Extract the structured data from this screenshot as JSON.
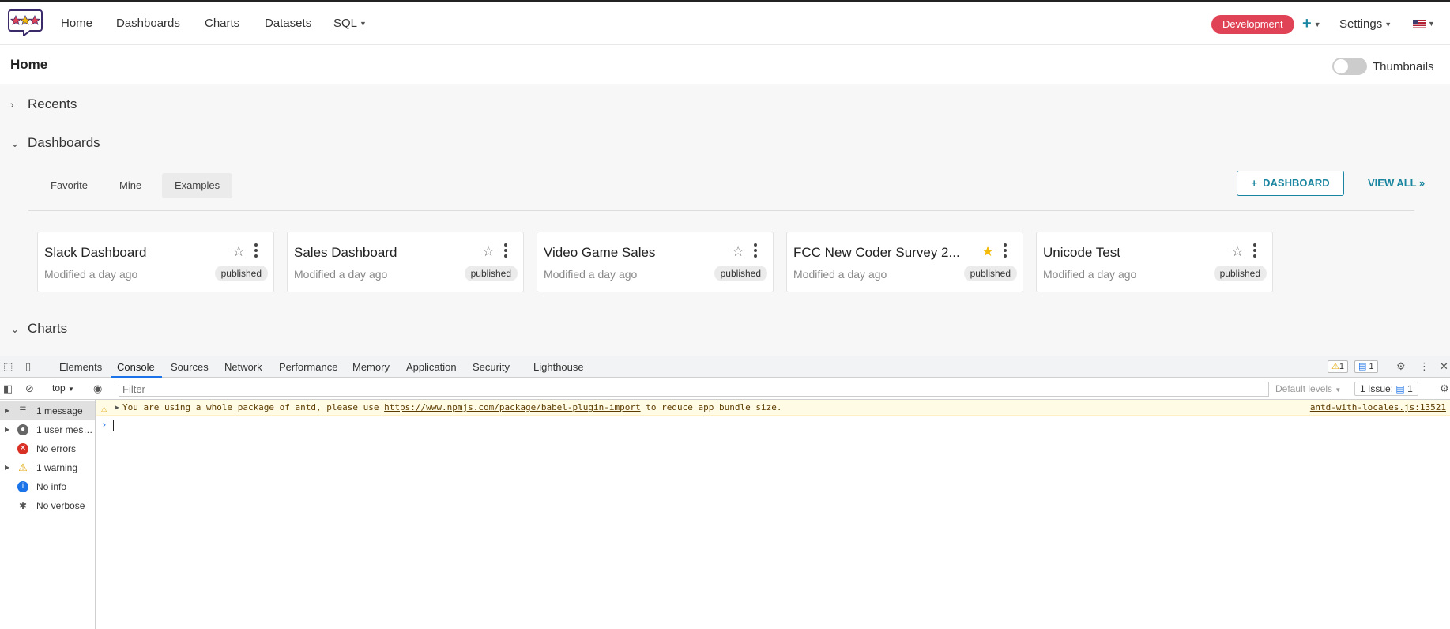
{
  "nav": {
    "links": [
      "Home",
      "Dashboards",
      "Charts",
      "Datasets",
      "SQL"
    ],
    "environment": "Development",
    "plus": "+",
    "settings": "Settings"
  },
  "page": {
    "title": "Home",
    "thumbnails_label": "Thumbnails",
    "thumbnails_on": false
  },
  "sections": {
    "recents": "Recents",
    "dashboards": "Dashboards",
    "charts": "Charts"
  },
  "dashboard_tabs": [
    "Favorite",
    "Mine",
    "Examples"
  ],
  "active_tab": "Examples",
  "actions": {
    "add_dashboard": "DASHBOARD",
    "view_all": "VIEW ALL »"
  },
  "cards": [
    {
      "title": "Slack Dashboard",
      "modified": "Modified a day ago",
      "status": "published",
      "favorite": false
    },
    {
      "title": "Sales Dashboard",
      "modified": "Modified a day ago",
      "status": "published",
      "favorite": false
    },
    {
      "title": "Video Game Sales",
      "modified": "Modified a day ago",
      "status": "published",
      "favorite": false
    },
    {
      "title": "FCC New Coder Survey 2...",
      "modified": "Modified a day ago",
      "status": "published",
      "favorite": true
    },
    {
      "title": "Unicode Test",
      "modified": "Modified a day ago",
      "status": "published",
      "favorite": false
    }
  ],
  "devtools": {
    "tabs": [
      "Elements",
      "Console",
      "Sources",
      "Network",
      "Performance",
      "Memory",
      "Application",
      "Security",
      "Lighthouse"
    ],
    "active_tab": "Console",
    "warning_count": "1",
    "message_count": "1",
    "context": "top",
    "filter_placeholder": "Filter",
    "levels": "Default levels",
    "issues_label": "1 Issue:",
    "issues_count": "1",
    "sidebar": [
      {
        "label": "1 message",
        "icon": "list-icon"
      },
      {
        "label": "1 user mes…",
        "icon": "user-icon"
      },
      {
        "label": "No errors",
        "icon": "error-icon"
      },
      {
        "label": "1 warning",
        "icon": "warning-icon"
      },
      {
        "label": "No info",
        "icon": "info-icon"
      },
      {
        "label": "No verbose",
        "icon": "verbose-icon"
      }
    ],
    "warning": {
      "prefix": "You are using a whole package of antd, please use ",
      "link": "https://www.npmjs.com/package/babel-plugin-import",
      "suffix": " to reduce app bundle size.",
      "source": "antd-with-locales.js:13521"
    }
  },
  "colors": {
    "brand": "#1a85a0",
    "env_badge": "#e04355",
    "favorite_star": "#f5bb0a"
  }
}
